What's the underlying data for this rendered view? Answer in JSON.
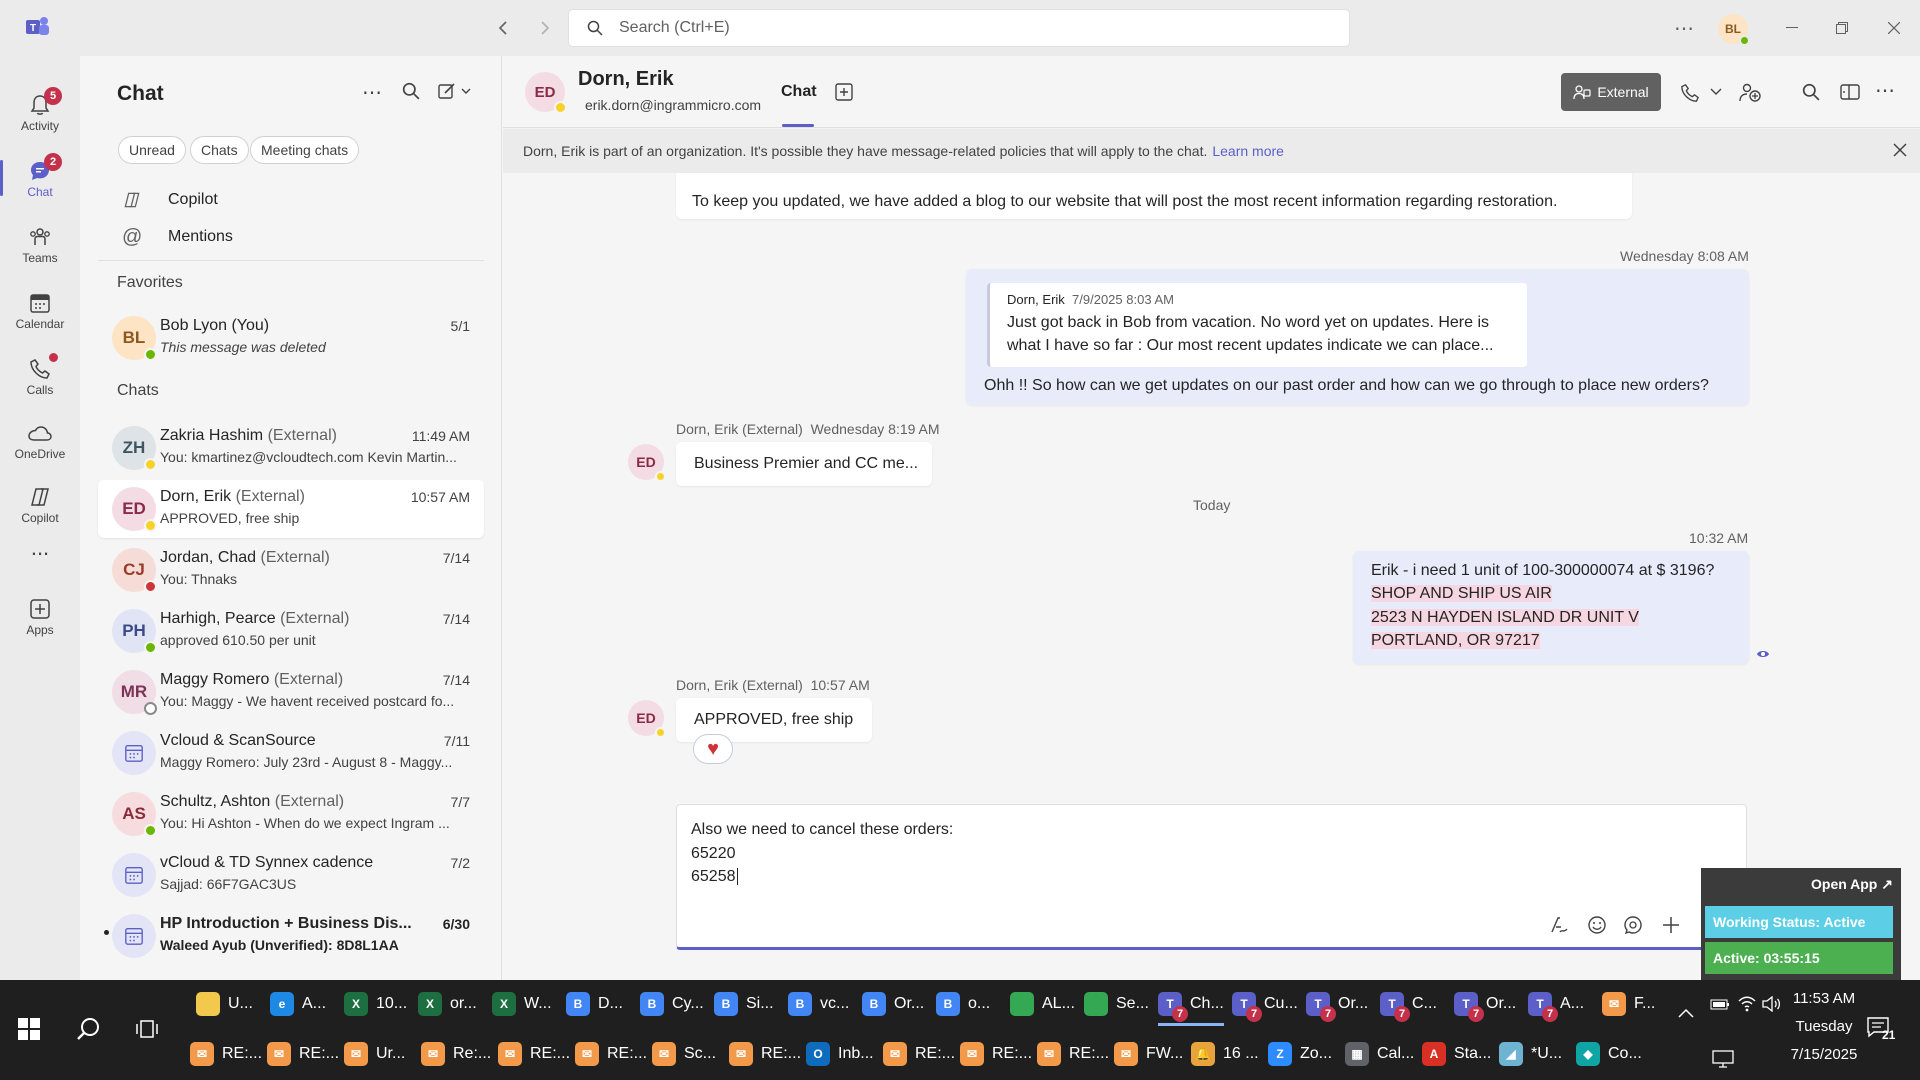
{
  "titlebar": {
    "search_placeholder": "Search (Ctrl+E)",
    "user_initials": "BL"
  },
  "rail": {
    "items": [
      {
        "label": "Activity",
        "badge": "5",
        "icon": "bell-icon"
      },
      {
        "label": "Chat",
        "badge": "2",
        "icon": "chat-icon"
      },
      {
        "label": "Teams",
        "icon": "teams-icon"
      },
      {
        "label": "Calendar",
        "icon": "calendar-icon"
      },
      {
        "label": "Calls",
        "icon": "phone-icon"
      },
      {
        "label": "OneDrive",
        "icon": "cloud-icon"
      },
      {
        "label": "Copilot",
        "icon": "copilot-icon"
      },
      {
        "label": "...",
        "icon": "more-icon"
      },
      {
        "label": "Apps",
        "icon": "apps-icon"
      }
    ]
  },
  "chatlist": {
    "title": "Chat",
    "filters": [
      "Unread",
      "Chats",
      "Meeting chats"
    ],
    "nav": [
      {
        "label": "Copilot",
        "icon": "copilot-icon"
      },
      {
        "label": "Mentions",
        "icon": "at-icon"
      }
    ],
    "favorites_label": "Favorites",
    "favorites": [
      {
        "initials": "BL",
        "name": "Bob Lyon (You)",
        "ext": "",
        "preview": "This message was deleted",
        "time": "5/1",
        "avatar_bg": "#fce4c4",
        "avatar_fg": "#8a5a1f",
        "status": "#6bb700"
      }
    ],
    "chats_label": "Chats",
    "chats": [
      {
        "initials": "ZH",
        "name": "Zakria Hashim",
        "ext": "(External)",
        "preview": "You: kmartinez@vcloudtech.com Kevin Martin...",
        "time": "11:49 AM",
        "avatar_bg": "#dde3e6",
        "avatar_fg": "#3d5560",
        "status": "#f8d22a",
        "selected": false,
        "bold": false
      },
      {
        "initials": "ED",
        "name": "Dorn, Erik",
        "ext": "(External)",
        "preview": "APPROVED, free ship",
        "time": "10:57 AM",
        "avatar_bg": "#f4dce4",
        "avatar_fg": "#8a2a47",
        "status": "#f8d22a",
        "selected": true,
        "bold": false
      },
      {
        "initials": "CJ",
        "name": "Jordan, Chad",
        "ext": "(External)",
        "preview": "You: Thnaks",
        "time": "7/14",
        "avatar_bg": "#f6dcd6",
        "avatar_fg": "#9a3a28",
        "status": "#d13438",
        "selected": false,
        "bold": false
      },
      {
        "initials": "PH",
        "name": "Harhigh, Pearce",
        "ext": "(External)",
        "preview": "approved 610.50 per unit",
        "time": "7/14",
        "avatar_bg": "#e1e4f5",
        "avatar_fg": "#3d4a8a",
        "status": "#6bb700",
        "selected": false,
        "bold": false
      },
      {
        "initials": "MR",
        "name": "Maggy Romero",
        "ext": "(External)",
        "preview": "You: Maggy - We havent received postcard fo...",
        "time": "7/14",
        "avatar_bg": "#f1dde6",
        "avatar_fg": "#7e3458",
        "status": "#ffffff",
        "selected": false,
        "bold": false
      },
      {
        "initials": "",
        "name": "Vcloud & ScanSource",
        "ext": "",
        "preview": "Maggy Romero: July 23rd - August 8 - Maggy...",
        "time": "7/11",
        "avatar_bg": "#e3e5f7",
        "avatar_fg": "#5b5fc7",
        "status": "",
        "selected": false,
        "bold": false,
        "icon": "calendar-icon"
      },
      {
        "initials": "AS",
        "name": "Schultz, Ashton",
        "ext": "(External)",
        "preview": "You: Hi Ashton -  When do we expect Ingram ...",
        "time": "7/7",
        "avatar_bg": "#f6dcdf",
        "avatar_fg": "#8a2a3b",
        "status": "#6bb700",
        "selected": false,
        "bold": false
      },
      {
        "initials": "",
        "name": "vCloud & TD Synnex cadence",
        "ext": "",
        "preview": "Sajjad: 66F7GAC3US",
        "time": "7/2",
        "avatar_bg": "#e3e5f7",
        "avatar_fg": "#5b5fc7",
        "status": "",
        "selected": false,
        "bold": false,
        "icon": "calendar-icon"
      },
      {
        "initials": "",
        "name": "HP Introduction + Business Dis...",
        "ext": "",
        "preview": "Waleed Ayub (Unverified): 8D8L1AA",
        "time": "6/30",
        "avatar_bg": "#e3e5f7",
        "avatar_fg": "#5b5fc7",
        "status": "",
        "selected": false,
        "bold": true,
        "icon": "calendar-icon"
      }
    ]
  },
  "header": {
    "initials": "ED",
    "name": "Dorn, Erik",
    "email": "erik.dorn@ingrammicro.com",
    "tab": "Chat",
    "external_label": "External"
  },
  "banner": {
    "text": "Dorn, Erik is part of an organization. It's possible they have message-related policies that will apply to the chat.",
    "link": "Learn more"
  },
  "messages": {
    "m0_text": "To keep you updated, we have added a blog to our website that will post the most recent information regarding restoration.",
    "m1_time": "Wednesday 8:08 AM",
    "m1_quote_author": "Dorn, Erik",
    "m1_quote_time": "7/9/2025 8:03 AM",
    "m1_quote_line1": "Just got back in Bob from vacation. No word yet on updates. Here is",
    "m1_quote_line2": "what I have so far : Our most recent updates indicate we can place...",
    "m1_text": "Ohh !! So how can we get updates on our past order and how can we go through to place new orders?",
    "m2_author": "Dorn, Erik (External)",
    "m2_time": "Wednesday 8:19 AM",
    "m2_text": "Business Premier and CC me...",
    "divider": "Today",
    "m3_time": "10:32 AM",
    "m3_line1": "Erik  -  i need 1 unit of 100-300000074 at $ 3196?",
    "m3_line2": "SHOP AND SHIP US AIR",
    "m3_line3": "2523 N HAYDEN ISLAND DR UNIT V",
    "m3_line4": "PORTLAND, OR 97217",
    "m4_author": "Dorn, Erik (External)",
    "m4_time": "10:57 AM",
    "m4_text": "APPROVED, free ship",
    "m4_reaction": "♥"
  },
  "composer": {
    "line1": "Also we need to cancel these orders:",
    "line2": "65220",
    "line3": "65258"
  },
  "widget": {
    "open_app": "Open App ↗",
    "status": "Working Status: Active",
    "timer": "Active: 03:55:15"
  },
  "taskbar": {
    "row1": [
      {
        "label": "U...",
        "color": "#f2c94c",
        "glyph": ""
      },
      {
        "label": "A...",
        "color": "#1e88e5",
        "glyph": "e"
      },
      {
        "label": "10...",
        "color": "#1d6f42",
        "glyph": "X"
      },
      {
        "label": "or...",
        "color": "#1d6f42",
        "glyph": "X"
      },
      {
        "label": "W...",
        "color": "#1d6f42",
        "glyph": "X"
      },
      {
        "label": "D...",
        "color": "#4285f4",
        "glyph": "B"
      },
      {
        "label": "Cy...",
        "color": "#4285f4",
        "glyph": "B"
      },
      {
        "label": "Si...",
        "color": "#4285f4",
        "glyph": "B"
      },
      {
        "label": "vc...",
        "color": "#4285f4",
        "glyph": "B"
      },
      {
        "label": "Or...",
        "color": "#4285f4",
        "glyph": "B"
      },
      {
        "label": "o...",
        "color": "#4285f4",
        "glyph": "B"
      },
      {
        "label": "AL...",
        "color": "#34a853",
        "glyph": ""
      },
      {
        "label": "Se...",
        "color": "#34a853",
        "glyph": ""
      },
      {
        "label": "Ch...",
        "color": "#5b5fc7",
        "glyph": "T"
      },
      {
        "label": "Cu...",
        "color": "#5b5fc7",
        "glyph": "T"
      },
      {
        "label": "Or...",
        "color": "#5b5fc7",
        "glyph": "T"
      },
      {
        "label": "C...",
        "color": "#5b5fc7",
        "glyph": "T"
      },
      {
        "label": "Or...",
        "color": "#5b5fc7",
        "glyph": "T"
      },
      {
        "label": "A...",
        "color": "#5b5fc7",
        "glyph": "T"
      },
      {
        "label": "F...",
        "color": "#f2994a",
        "glyph": "✉"
      }
    ],
    "row2": [
      {
        "label": "RE:...",
        "color": "#f2994a",
        "glyph": "✉"
      },
      {
        "label": "RE:...",
        "color": "#f2994a",
        "glyph": "✉"
      },
      {
        "label": "Ur...",
        "color": "#f2994a",
        "glyph": "✉"
      },
      {
        "label": "Re:...",
        "color": "#f2994a",
        "glyph": "✉"
      },
      {
        "label": "RE:...",
        "color": "#f2994a",
        "glyph": "✉"
      },
      {
        "label": "RE:...",
        "color": "#f2994a",
        "glyph": "✉"
      },
      {
        "label": "Sc...",
        "color": "#f2994a",
        "glyph": "✉"
      },
      {
        "label": "RE:...",
        "color": "#f2994a",
        "glyph": "✉"
      },
      {
        "label": "Inb...",
        "color": "#0f6cbd",
        "glyph": "O"
      },
      {
        "label": "RE:...",
        "color": "#f2994a",
        "glyph": "✉"
      },
      {
        "label": "RE:...",
        "color": "#f2994a",
        "glyph": "✉"
      },
      {
        "label": "RE:...",
        "color": "#f2994a",
        "glyph": "✉"
      },
      {
        "label": "FW...",
        "color": "#f2994a",
        "glyph": "✉"
      },
      {
        "label": "16 ...",
        "color": "#e8a33d",
        "glyph": "🔔"
      },
      {
        "label": "Zo...",
        "color": "#2d8cff",
        "glyph": "Z"
      },
      {
        "label": "Cal...",
        "color": "#5f6368",
        "glyph": "▦"
      },
      {
        "label": "Sta...",
        "color": "#d93025",
        "glyph": "A"
      },
      {
        "label": "*U...",
        "color": "#6fb3d2",
        "glyph": "◢"
      },
      {
        "label": "Co...",
        "color": "#0ea5a4",
        "glyph": "◆"
      }
    ],
    "time": "11:53 AM",
    "day": "Tuesday",
    "date": "7/15/2025",
    "notifications": "21"
  }
}
